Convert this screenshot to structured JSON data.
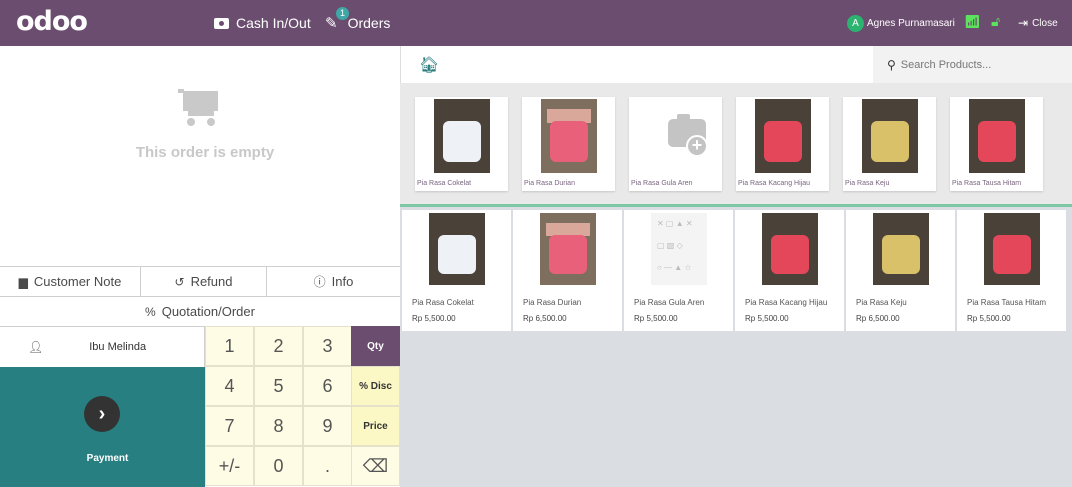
{
  "topbar": {
    "logo": "odoo",
    "cash_label": "Cash In/Out",
    "orders_label": "Orders",
    "orders_badge": "1",
    "user_initial": "A",
    "user_name": "Agnes Purnamasari",
    "close_label": "Close",
    "colors": {
      "bar": "#6b4e6f",
      "status_icons": "#5de25d",
      "badge": "#3fa7a6"
    }
  },
  "order": {
    "empty_text": "This order is empty"
  },
  "controls": {
    "customer_note": "Customer Note",
    "refund": "Refund",
    "info": "Info",
    "quotation": "Quotation/Order"
  },
  "pad": {
    "customer": "Ibu Melinda",
    "payment": "Payment",
    "keys": {
      "k1": "1",
      "k2": "2",
      "k3": "3",
      "k4": "4",
      "k5": "5",
      "k6": "6",
      "k7": "7",
      "k8": "8",
      "k9": "9",
      "plusminus": "+/-",
      "k0": "0",
      "dot": ".",
      "backspace": "⌫"
    },
    "modes": {
      "qty": "Qty",
      "disc": "% Disc",
      "price": "Price"
    },
    "active_mode": "Qty",
    "colors": {
      "payment": "#287f81",
      "active_mode": "#6b4e6f",
      "key_bg": "#fffce6"
    }
  },
  "search": {
    "placeholder": "Search Products..."
  },
  "categories": [
    {
      "label": "Pia Rasa Cokelat",
      "icon": "pia-white"
    },
    {
      "label": "Pia Rasa Durian",
      "icon": "pia-durian"
    },
    {
      "label": "Pia Rasa Gula Aren",
      "icon": "camera-placeholder-icon"
    },
    {
      "label": "Pia Rasa Kacang Hijau",
      "icon": "pia-red"
    },
    {
      "label": "Pia Rasa Keju",
      "icon": "pia-yellow"
    },
    {
      "label": "Pia Rasa Tausa Hitam",
      "icon": "pia-red"
    }
  ],
  "products": [
    {
      "name": "Pia Rasa Cokelat",
      "price": "Rp 5,500.00"
    },
    {
      "name": "Pia Rasa Durian",
      "price": "Rp 6,500.00"
    },
    {
      "name": "Pia Rasa Gula Aren",
      "price": "Rp 5,500.00"
    },
    {
      "name": "Pia Rasa Kacang Hijau",
      "price": "Rp 5,500.00"
    },
    {
      "name": "Pia Rasa Keju",
      "price": "Rp 6,500.00"
    },
    {
      "name": "Pia Rasa Tausa Hitam",
      "price": "Rp 5,500.00"
    }
  ]
}
